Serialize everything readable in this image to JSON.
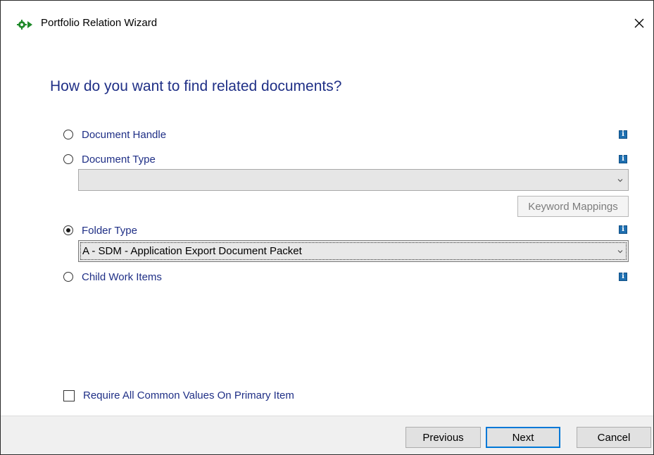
{
  "window": {
    "title": "Portfolio Relation Wizard",
    "close_glyph": "✕"
  },
  "heading": "How do you want to find related documents?",
  "options": [
    {
      "label": "Document Handle",
      "checked": false
    },
    {
      "label": "Document Type",
      "checked": false
    },
    {
      "label": "Folder Type",
      "checked": true
    },
    {
      "label": "Child Work Items",
      "checked": false
    }
  ],
  "document_type_combo": {
    "value": ""
  },
  "folder_type_combo": {
    "value": "A - SDM - Application Export Document Packet"
  },
  "keyword_mappings_label": "Keyword Mappings",
  "info_glyph": "i",
  "require_common": {
    "label": "Require All Common Values On Primary Item",
    "checked": false
  },
  "buttons": {
    "previous": "Previous",
    "next": "Next",
    "cancel": "Cancel"
  },
  "colors": {
    "heading": "#1f2f86",
    "label": "#1f2f86",
    "info_icon": "#1e6fb0",
    "default_button_border": "#0078d7"
  }
}
